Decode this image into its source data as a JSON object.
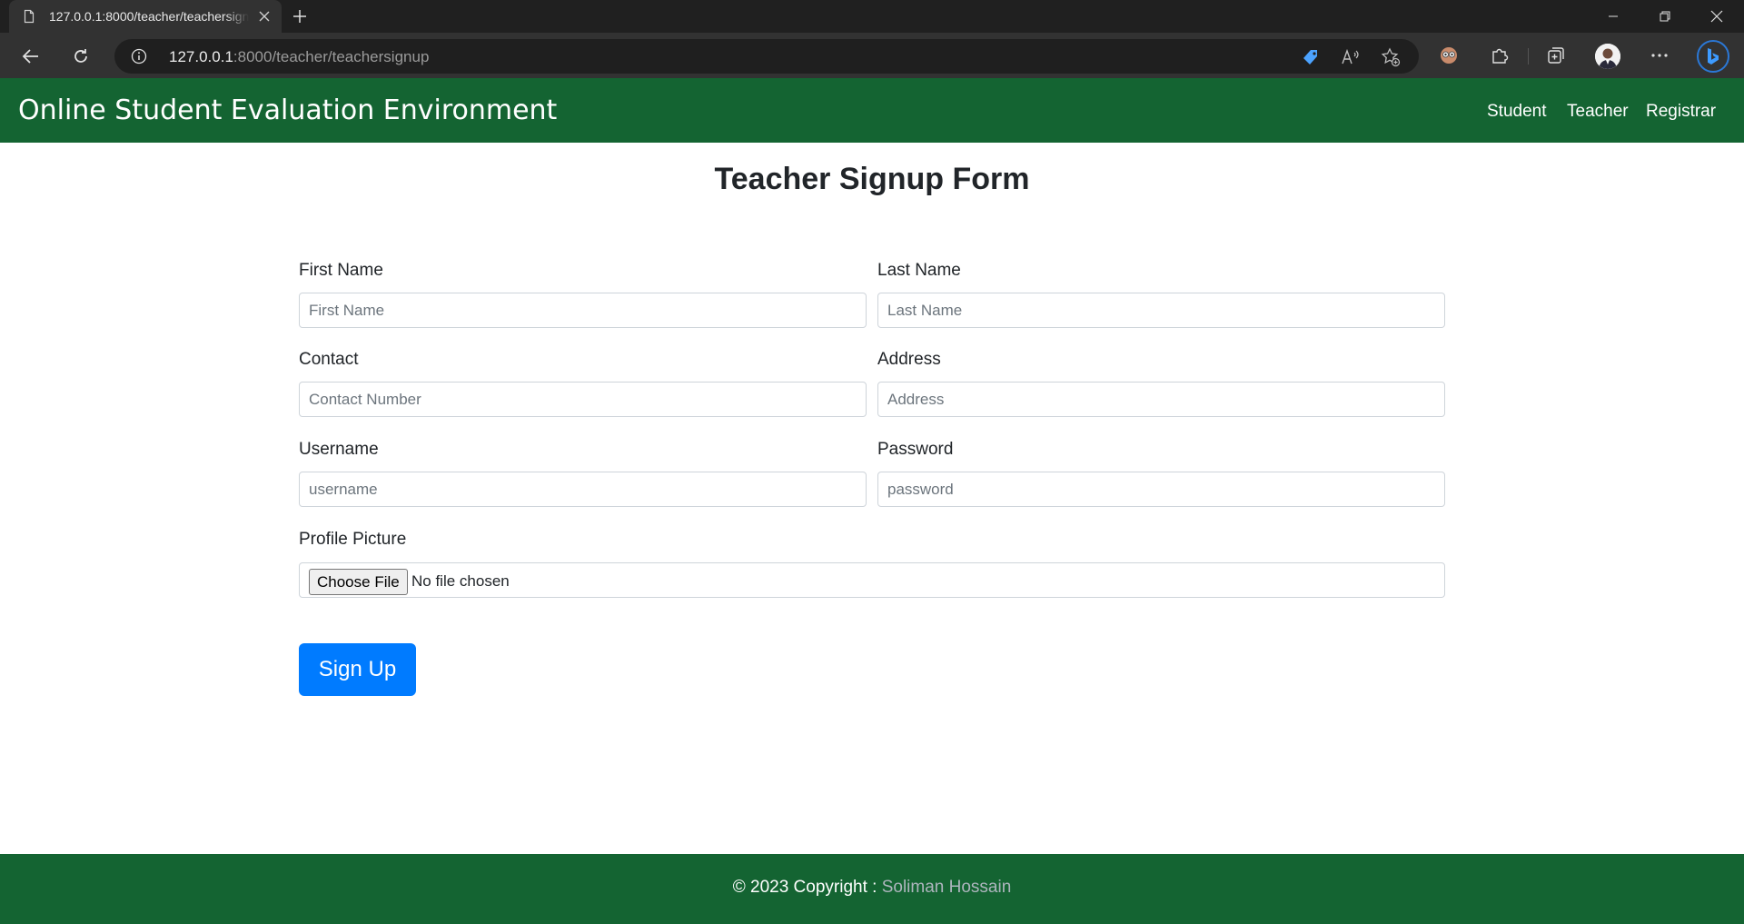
{
  "browser": {
    "tab_title": "127.0.0.1:8000/teacher/teachersignup",
    "url_host": "127.0.0.1",
    "url_rest": ":8000/teacher/teachersignup"
  },
  "site": {
    "brand": "Online Student Evaluation Environment",
    "nav": [
      "Student",
      "Teacher",
      "Registrar"
    ],
    "brand_color": "#146432"
  },
  "form": {
    "title": "Teacher Signup Form",
    "fields": {
      "first_name": {
        "label": "First Name",
        "placeholder": "First Name"
      },
      "last_name": {
        "label": "Last Name",
        "placeholder": "Last Name"
      },
      "contact": {
        "label": "Contact",
        "placeholder": "Contact Number"
      },
      "address": {
        "label": "Address",
        "placeholder": "Address"
      },
      "username": {
        "label": "Username",
        "placeholder": "username"
      },
      "password": {
        "label": "Password",
        "placeholder": "password"
      }
    },
    "profile_picture": {
      "label": "Profile Picture",
      "button": "Choose File",
      "status": "No file chosen"
    },
    "submit": "Sign Up",
    "submit_color": "#007bff"
  },
  "footer": {
    "prefix": "© 2023 Copyright : ",
    "author": "Soliman Hossain"
  }
}
